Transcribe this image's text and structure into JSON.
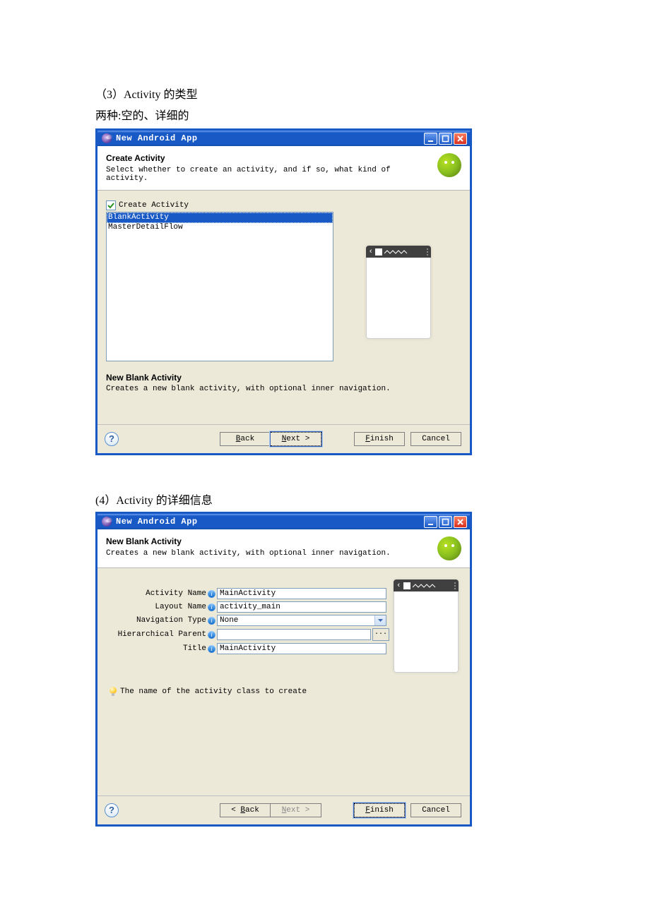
{
  "doc": {
    "heading3": "（3）Activity 的类型",
    "subheading3": "两种:空的、详细的",
    "heading4": "(4）Activity 的详细信息"
  },
  "dialog1": {
    "window_title": "New Android App",
    "header_title": "Create Activity",
    "header_desc": "Select whether to create an activity, and if so, what kind of activity.",
    "checkbox_label": "Create Activity",
    "items": {
      "0": "BlankActivity",
      "1": "MasterDetailFlow"
    },
    "desc_title": "New Blank Activity",
    "desc_text": "Creates a new blank activity, with optional inner navigation.",
    "buttons": {
      "back": "< Back",
      "next": "Next >",
      "finish": "Finish",
      "cancel": "Cancel"
    }
  },
  "dialog2": {
    "window_title": "New Android App",
    "header_title": "New Blank Activity",
    "header_desc": "Creates a new blank activity, with optional inner navigation.",
    "fields": {
      "activity_name": {
        "label": "Activity Name",
        "value": "MainActivity"
      },
      "layout_name": {
        "label": "Layout Name",
        "value": "activity_main"
      },
      "nav_type": {
        "label": "Navigation Type",
        "value": "None"
      },
      "hier_parent": {
        "label": "Hierarchical Parent",
        "value": ""
      },
      "title": {
        "label": "Title",
        "value": "MainActivity"
      }
    },
    "hint": "The name of the activity class to create",
    "buttons": {
      "back": "< Back",
      "next": "Next >",
      "finish": "Finish",
      "cancel": "Cancel"
    },
    "browse": "..."
  }
}
